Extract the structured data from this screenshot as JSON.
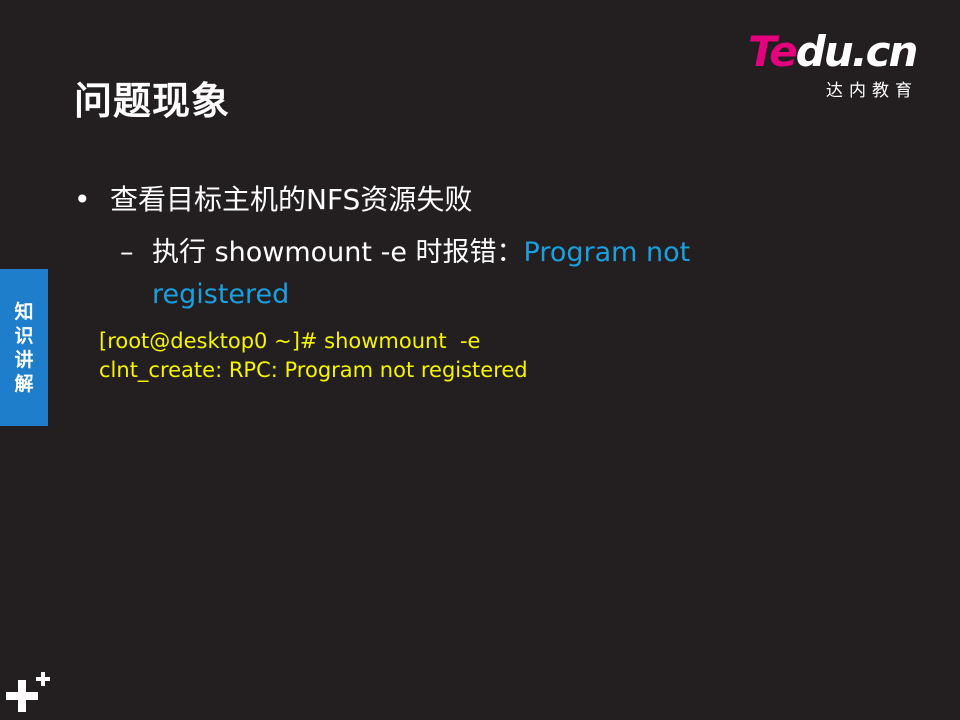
{
  "slide": {
    "title": "问题现象",
    "logo": {
      "brand_part1": "Te",
      "brand_part2": "du.cn",
      "subtitle": "达内教育"
    },
    "bullet_level1": {
      "marker": "•",
      "text": "查看目标主机的NFS资源失败"
    },
    "bullet_level2": {
      "marker": "–",
      "text_prefix": "执行 showmount -e 时报错：",
      "text_highlight": "Program not registered"
    },
    "code_lines": [
      "[root@desktop0 ~]# showmount  -e",
      "clnt_create: RPC: Program not registered"
    ],
    "side_tab_label": "知识讲解",
    "colors": {
      "background": "#231f20",
      "highlight_blue": "#1aa0e0",
      "code_yellow": "#f5f500",
      "side_tab_blue": "#1e7ecb",
      "logo_magenta": "#e5007e"
    },
    "icons": {
      "bottom_left": "plus-icon"
    }
  }
}
